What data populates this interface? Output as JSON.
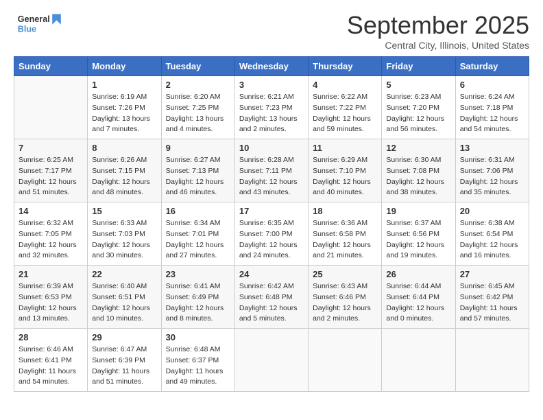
{
  "header": {
    "logo_line1": "General",
    "logo_line2": "Blue",
    "month": "September 2025",
    "location": "Central City, Illinois, United States"
  },
  "days_of_week": [
    "Sunday",
    "Monday",
    "Tuesday",
    "Wednesday",
    "Thursday",
    "Friday",
    "Saturday"
  ],
  "weeks": [
    [
      {
        "num": "",
        "info": ""
      },
      {
        "num": "1",
        "info": "Sunrise: 6:19 AM\nSunset: 7:26 PM\nDaylight: 13 hours\nand 7 minutes."
      },
      {
        "num": "2",
        "info": "Sunrise: 6:20 AM\nSunset: 7:25 PM\nDaylight: 13 hours\nand 4 minutes."
      },
      {
        "num": "3",
        "info": "Sunrise: 6:21 AM\nSunset: 7:23 PM\nDaylight: 13 hours\nand 2 minutes."
      },
      {
        "num": "4",
        "info": "Sunrise: 6:22 AM\nSunset: 7:22 PM\nDaylight: 12 hours\nand 59 minutes."
      },
      {
        "num": "5",
        "info": "Sunrise: 6:23 AM\nSunset: 7:20 PM\nDaylight: 12 hours\nand 56 minutes."
      },
      {
        "num": "6",
        "info": "Sunrise: 6:24 AM\nSunset: 7:18 PM\nDaylight: 12 hours\nand 54 minutes."
      }
    ],
    [
      {
        "num": "7",
        "info": "Sunrise: 6:25 AM\nSunset: 7:17 PM\nDaylight: 12 hours\nand 51 minutes."
      },
      {
        "num": "8",
        "info": "Sunrise: 6:26 AM\nSunset: 7:15 PM\nDaylight: 12 hours\nand 48 minutes."
      },
      {
        "num": "9",
        "info": "Sunrise: 6:27 AM\nSunset: 7:13 PM\nDaylight: 12 hours\nand 46 minutes."
      },
      {
        "num": "10",
        "info": "Sunrise: 6:28 AM\nSunset: 7:11 PM\nDaylight: 12 hours\nand 43 minutes."
      },
      {
        "num": "11",
        "info": "Sunrise: 6:29 AM\nSunset: 7:10 PM\nDaylight: 12 hours\nand 40 minutes."
      },
      {
        "num": "12",
        "info": "Sunrise: 6:30 AM\nSunset: 7:08 PM\nDaylight: 12 hours\nand 38 minutes."
      },
      {
        "num": "13",
        "info": "Sunrise: 6:31 AM\nSunset: 7:06 PM\nDaylight: 12 hours\nand 35 minutes."
      }
    ],
    [
      {
        "num": "14",
        "info": "Sunrise: 6:32 AM\nSunset: 7:05 PM\nDaylight: 12 hours\nand 32 minutes."
      },
      {
        "num": "15",
        "info": "Sunrise: 6:33 AM\nSunset: 7:03 PM\nDaylight: 12 hours\nand 30 minutes."
      },
      {
        "num": "16",
        "info": "Sunrise: 6:34 AM\nSunset: 7:01 PM\nDaylight: 12 hours\nand 27 minutes."
      },
      {
        "num": "17",
        "info": "Sunrise: 6:35 AM\nSunset: 7:00 PM\nDaylight: 12 hours\nand 24 minutes."
      },
      {
        "num": "18",
        "info": "Sunrise: 6:36 AM\nSunset: 6:58 PM\nDaylight: 12 hours\nand 21 minutes."
      },
      {
        "num": "19",
        "info": "Sunrise: 6:37 AM\nSunset: 6:56 PM\nDaylight: 12 hours\nand 19 minutes."
      },
      {
        "num": "20",
        "info": "Sunrise: 6:38 AM\nSunset: 6:54 PM\nDaylight: 12 hours\nand 16 minutes."
      }
    ],
    [
      {
        "num": "21",
        "info": "Sunrise: 6:39 AM\nSunset: 6:53 PM\nDaylight: 12 hours\nand 13 minutes."
      },
      {
        "num": "22",
        "info": "Sunrise: 6:40 AM\nSunset: 6:51 PM\nDaylight: 12 hours\nand 10 minutes."
      },
      {
        "num": "23",
        "info": "Sunrise: 6:41 AM\nSunset: 6:49 PM\nDaylight: 12 hours\nand 8 minutes."
      },
      {
        "num": "24",
        "info": "Sunrise: 6:42 AM\nSunset: 6:48 PM\nDaylight: 12 hours\nand 5 minutes."
      },
      {
        "num": "25",
        "info": "Sunrise: 6:43 AM\nSunset: 6:46 PM\nDaylight: 12 hours\nand 2 minutes."
      },
      {
        "num": "26",
        "info": "Sunrise: 6:44 AM\nSunset: 6:44 PM\nDaylight: 12 hours\nand 0 minutes."
      },
      {
        "num": "27",
        "info": "Sunrise: 6:45 AM\nSunset: 6:42 PM\nDaylight: 11 hours\nand 57 minutes."
      }
    ],
    [
      {
        "num": "28",
        "info": "Sunrise: 6:46 AM\nSunset: 6:41 PM\nDaylight: 11 hours\nand 54 minutes."
      },
      {
        "num": "29",
        "info": "Sunrise: 6:47 AM\nSunset: 6:39 PM\nDaylight: 11 hours\nand 51 minutes."
      },
      {
        "num": "30",
        "info": "Sunrise: 6:48 AM\nSunset: 6:37 PM\nDaylight: 11 hours\nand 49 minutes."
      },
      {
        "num": "",
        "info": ""
      },
      {
        "num": "",
        "info": ""
      },
      {
        "num": "",
        "info": ""
      },
      {
        "num": "",
        "info": ""
      }
    ]
  ]
}
